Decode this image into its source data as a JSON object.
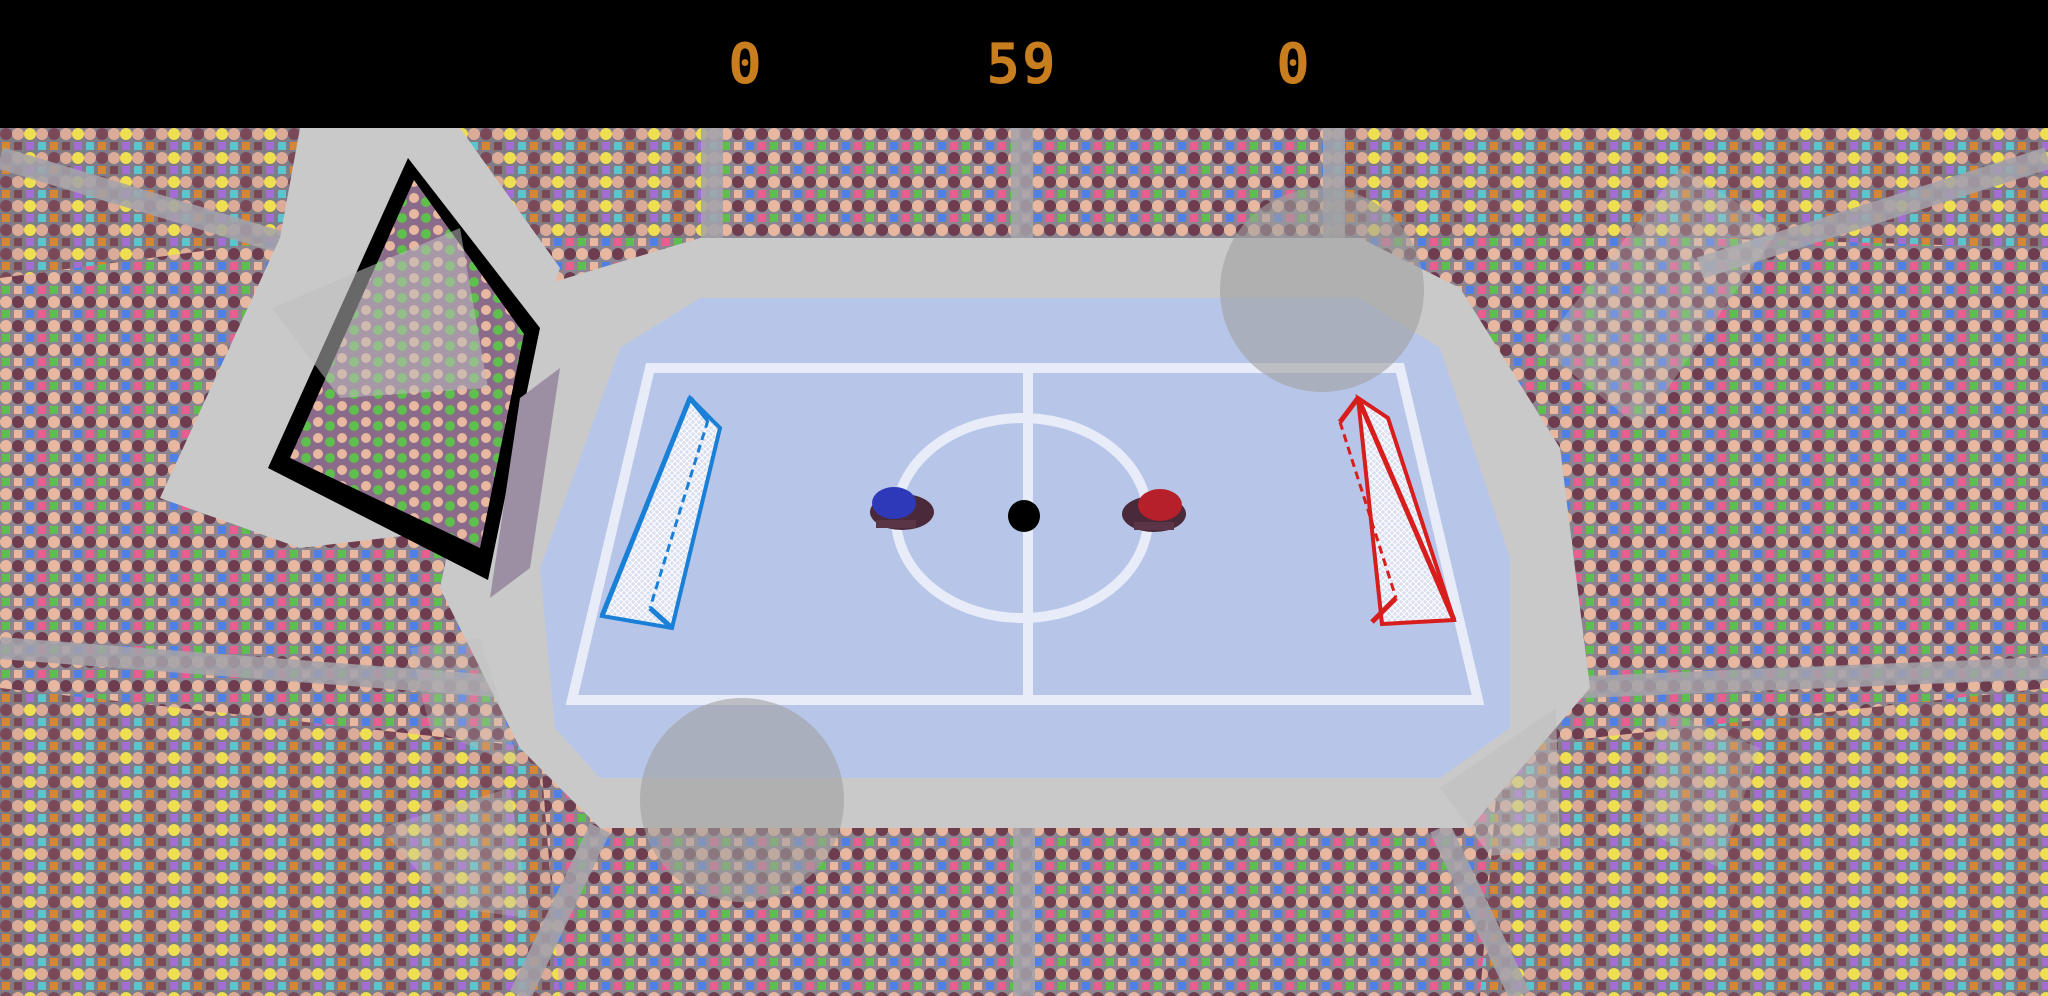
{
  "scoreboard": {
    "left_score": "0",
    "timer": "59",
    "right_score": "0"
  },
  "colors": {
    "scoreboard_text": "#c87d1e",
    "ice": "#b7c6e8",
    "rink_lines": "#e8ebf8",
    "board": "#c9c9c9",
    "blue_team": "#1a7fd6",
    "red_team": "#d81d1d",
    "blue_paddle": "#2d39b8",
    "red_paddle": "#b5202a",
    "puck": "#000000",
    "crowd_colors": [
      "#e8b79f",
      "#6d3d4f",
      "#e8b79f",
      "#6d3d4f",
      "#f0e14a",
      "#5fbf4c",
      "#4f7fe8",
      "#e85f8f",
      "#e87f2f",
      "#b06ad4",
      "#4fcfcf",
      "#e8b79f"
    ]
  },
  "icons": {
    "paddle_left": "blue-paddle-icon",
    "paddle_right": "red-paddle-icon",
    "puck": "puck-icon",
    "goal_left": "blue-goal-icon",
    "goal_right": "red-goal-icon",
    "joystick": "joystick-circle-icon",
    "arrow": "triangle-arrow-icon"
  }
}
